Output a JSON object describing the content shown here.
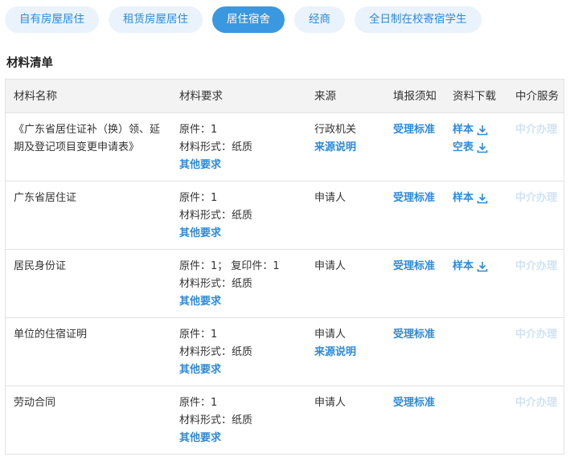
{
  "tabs": [
    {
      "label": "自有房屋居住",
      "active": false
    },
    {
      "label": "租赁房屋居住",
      "active": false
    },
    {
      "label": "居住宿舍",
      "active": true
    },
    {
      "label": "经商",
      "active": false
    },
    {
      "label": "全日制在校寄宿学生",
      "active": false
    }
  ],
  "section_title": "材料清单",
  "table": {
    "headers": [
      "材料名称",
      "材料要求",
      "来源",
      "填报须知",
      "资料下载",
      "中介服务"
    ],
    "rows": [
      {
        "name_line1": "《广东省居住证补（换）领、延",
        "name_line2": "期及登记项目变更申请表》",
        "req1": "原件：1",
        "req2": "材料形式：纸质",
        "req_link": "其他要求",
        "source": "行政机关",
        "source_link": "来源说明",
        "notice": "受理标准",
        "download1": "样本",
        "download2": "空表",
        "agency": "中介办理"
      },
      {
        "name_line1": "广东省居住证",
        "req1": "原件：1",
        "req2": "材料形式：纸质",
        "req_link": "其他要求",
        "source": "申请人",
        "notice": "受理标准",
        "download1": "样本",
        "agency": "中介办理"
      },
      {
        "name_line1": "居民身份证",
        "req1": "原件：1； 复印件：1",
        "req2": "材料形式：纸质",
        "req_link": "其他要求",
        "source": "申请人",
        "notice": "受理标准",
        "download1": "样本",
        "agency": "中介办理"
      },
      {
        "name_line1": "单位的住宿证明",
        "req1": "原件：1",
        "req2": "材料形式：纸质",
        "req_link": "其他要求",
        "source": "申请人",
        "source_link": "来源说明",
        "notice": "受理标准",
        "agency": "中介办理"
      },
      {
        "name_line1": "劳动合同",
        "req1": "原件：1",
        "req2": "材料形式：纸质",
        "req_link": "其他要求",
        "source": "申请人",
        "notice": "受理标准",
        "agency": "中介办理"
      }
    ]
  },
  "colors": {
    "accent": "#3a98e1",
    "link": "#2e8ad8",
    "muted": "#cfe3f5"
  }
}
